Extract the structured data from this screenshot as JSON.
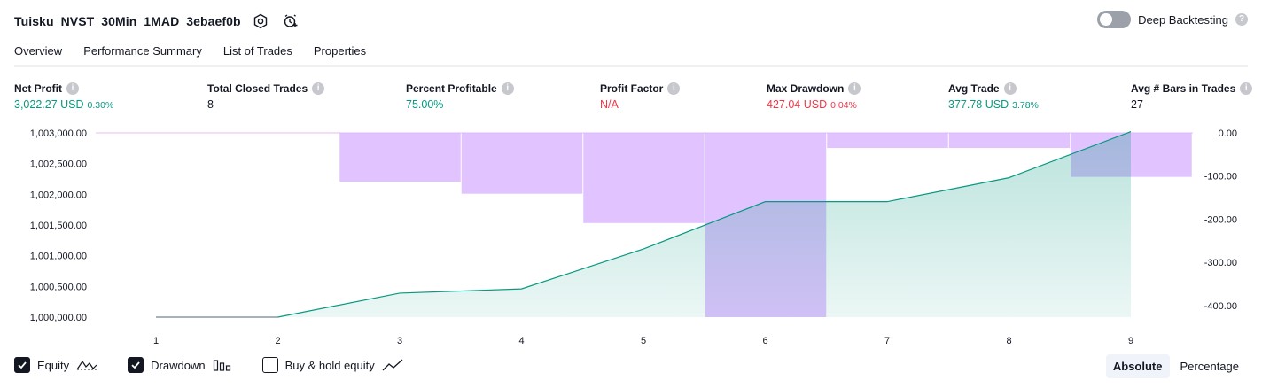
{
  "header": {
    "strategy_name": "Tuisku_NVST_30Min_1MAD_3ebaef0b",
    "deep_backtesting_label": "Deep Backtesting",
    "deep_backtesting_on": false
  },
  "tabs": [
    {
      "label": "Overview",
      "active": true
    },
    {
      "label": "Performance Summary",
      "active": false
    },
    {
      "label": "List of Trades",
      "active": false
    },
    {
      "label": "Properties",
      "active": false
    }
  ],
  "metrics": [
    {
      "label": "Net Profit",
      "value": "3,022.27 USD",
      "pct": "0.30%",
      "color": "#089981"
    },
    {
      "label": "Total Closed Trades",
      "value": "8",
      "pct": "",
      "color": "#131722"
    },
    {
      "label": "Percent Profitable",
      "value": "75.00%",
      "pct": "",
      "color": "#089981"
    },
    {
      "label": "Profit Factor",
      "value": "N/A",
      "pct": "",
      "color": "#f23645"
    },
    {
      "label": "Max Drawdown",
      "value": "427.04 USD",
      "pct": "0.04%",
      "color": "#f23645"
    },
    {
      "label": "Avg Trade",
      "value": "377.78 USD",
      "pct": "3.78%",
      "color": "#089981"
    },
    {
      "label": "Avg # Bars in Trades",
      "value": "27",
      "pct": "",
      "color": "#131722"
    }
  ],
  "chart_data": {
    "type": "area",
    "x": [
      1,
      2,
      3,
      4,
      5,
      6,
      7,
      8,
      9
    ],
    "series": [
      {
        "values": [
          1000000,
          1000000,
          1000390,
          1000460,
          1001110,
          1001880,
          1001880,
          1002270,
          1003020
        ],
        "axis": "left",
        "color": "#089981"
      },
      {
        "values": [
          0,
          0,
          -113,
          -141,
          -209,
          -427,
          -35,
          -35,
          -102
        ],
        "axis": "right",
        "color": "#d9b3ff"
      }
    ],
    "left_ticks": [
      "1,003,000.00",
      "1,002,500.00",
      "1,002,000.00",
      "1,001,500.00",
      "1,001,000.00",
      "1,000,500.00",
      "1,000,000.00"
    ],
    "right_ticks": [
      "0.00",
      "-100.00",
      "-200.00",
      "-300.00",
      "-400.00"
    ],
    "x_ticks": [
      "1",
      "2",
      "3",
      "4",
      "5",
      "6",
      "7",
      "8",
      "9"
    ],
    "left_range": [
      1000000,
      1003000
    ],
    "right_range": [
      -427,
      0
    ]
  },
  "legend": [
    {
      "label": "Equity",
      "checked": true,
      "icon": "equity-line-icon"
    },
    {
      "label": "Drawdown",
      "checked": true,
      "icon": "drawdown-bars-icon"
    },
    {
      "label": "Buy & hold equity",
      "checked": false,
      "icon": "buy-hold-line-icon"
    }
  ],
  "mode": {
    "absolute_label": "Absolute",
    "percentage_label": "Percentage",
    "selected": "Absolute"
  }
}
